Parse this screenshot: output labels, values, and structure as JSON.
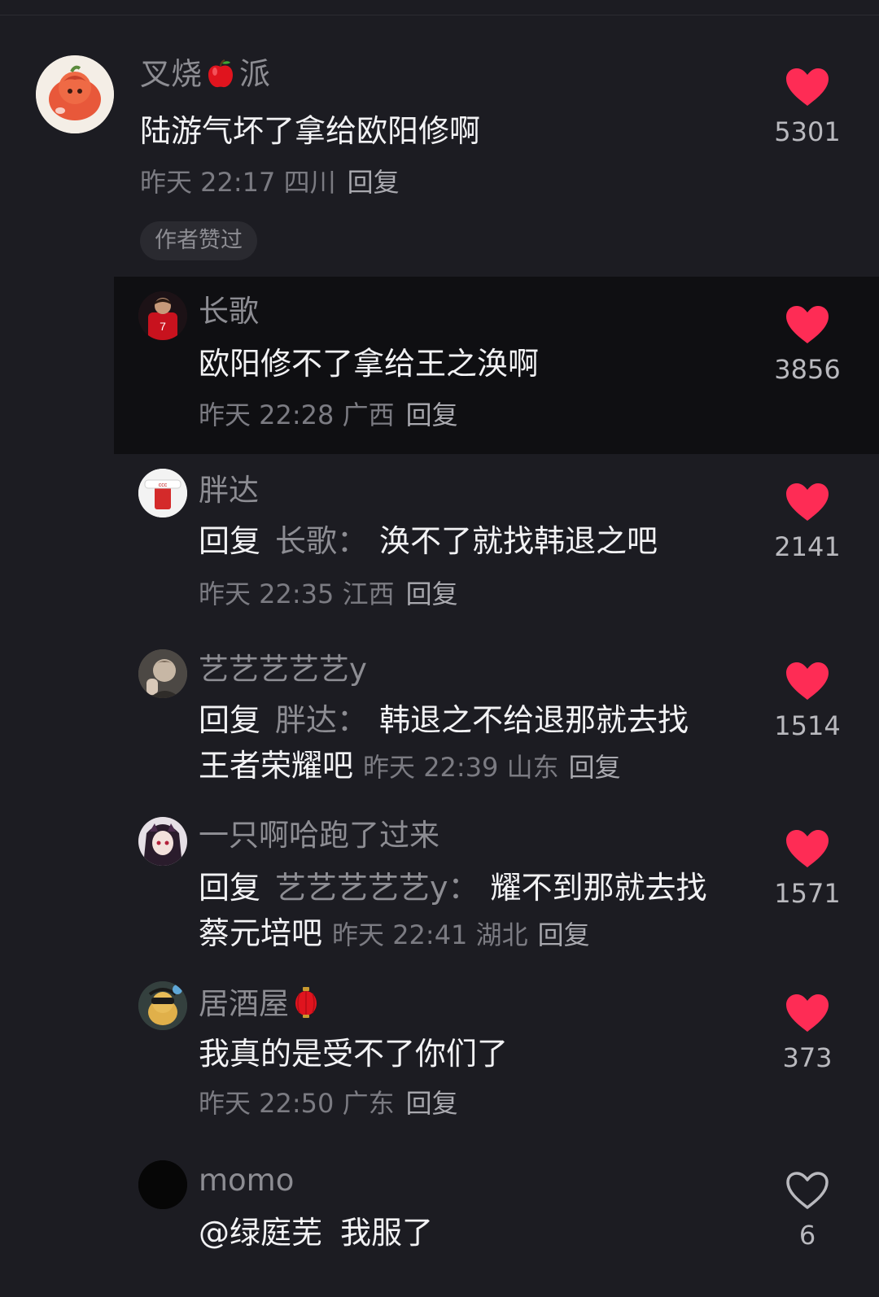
{
  "comments": [
    {
      "user": "叉烧",
      "user_suffix": "派",
      "user_emoji": "apple-emoji",
      "text": "陆游气坏了拿给欧阳修啊",
      "meta": "昨天 22:17 四川",
      "reply_label": "回复",
      "badge": "作者赞过",
      "likes": "5301",
      "liked": true
    }
  ],
  "replies": [
    {
      "user": "长歌",
      "text": "欧阳修不了拿给王之涣啊",
      "meta": "昨天 22:28 广西",
      "reply_label": "回复",
      "likes": "3856",
      "liked": true,
      "highlighted": true
    },
    {
      "user": "胖达",
      "reply_word": "回复",
      "reply_target": "长歌",
      "colon": "：",
      "text": "涣不了就找韩退之吧",
      "meta": "昨天 22:35 江西",
      "reply_label": "回复",
      "likes": "2141",
      "liked": true
    },
    {
      "user": "艺艺艺艺艺y",
      "reply_word": "回复",
      "reply_target": "胖达",
      "colon": "：",
      "text_line1": "韩退之不给退那就去找",
      "text_line2": "王者荣耀吧",
      "meta": "昨天 22:39 山东",
      "reply_label": "回复",
      "likes": "1514",
      "liked": true
    },
    {
      "user": "一只啊哈跑了过来",
      "reply_word": "回复",
      "reply_target": "艺艺艺艺艺y",
      "colon": "：",
      "text_line1": "耀不到那就去找",
      "text_line2": "蔡元培吧",
      "meta": "昨天 22:41 湖北",
      "reply_label": "回复",
      "likes": "1571",
      "liked": true
    },
    {
      "user": "居酒屋",
      "user_emoji": "red-lantern-emoji",
      "text": "我真的是受不了你们了",
      "meta": "昨天 22:50 广东",
      "reply_label": "回复",
      "likes": "373",
      "liked": true
    },
    {
      "user": "momo",
      "mention": "@绿庭芜",
      "text": "我服了",
      "likes": "6",
      "liked": false
    }
  ],
  "colors": {
    "background": "#1c1c22",
    "highlight_background": "#0f0f12",
    "like_red": "#fe2c55",
    "secondary_text": "#8d8d93",
    "primary_text": "#f2f2f4"
  },
  "icons": {
    "like_filled": "heart-filled-icon",
    "like_outline": "heart-outline-icon"
  }
}
